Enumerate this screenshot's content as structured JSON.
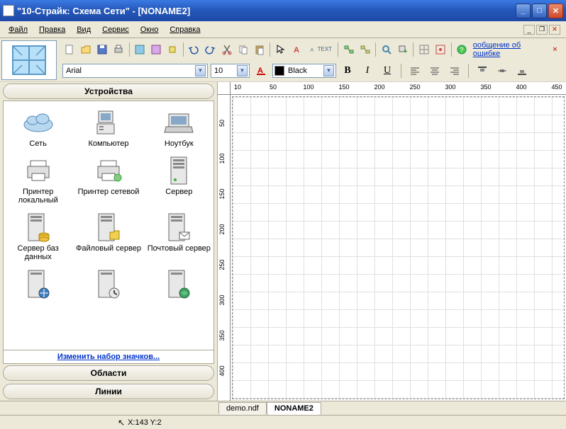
{
  "title": "\"10-Страйк: Схема Сети\" - [NONAME2]",
  "menu": {
    "file": "Файл",
    "edit": "Правка",
    "view": "Вид",
    "service": "Сервис",
    "window": "Окно",
    "help": "Справка"
  },
  "error_link": "ообщение об ошибке",
  "font": {
    "name": "Arial",
    "size": "10"
  },
  "color": {
    "label": "Black",
    "hex": "#000000"
  },
  "format_buttons": {
    "bold": "B",
    "italic": "I",
    "underline": "U"
  },
  "panel": {
    "devices_header": "Устройства",
    "areas_header": "Области",
    "lines_header": "Линии",
    "change_icons": "Изменить набор значков..."
  },
  "devices": [
    {
      "label": "Сеть",
      "icon": "cloud"
    },
    {
      "label": "Компьютер",
      "icon": "computer"
    },
    {
      "label": "Ноутбук",
      "icon": "laptop"
    },
    {
      "label": "Принтер локальный",
      "icon": "printer"
    },
    {
      "label": "Принтер сетевой",
      "icon": "net-printer"
    },
    {
      "label": "Сервер",
      "icon": "server"
    },
    {
      "label": "Сервер баз данных",
      "icon": "db-server"
    },
    {
      "label": "Файловый сервер",
      "icon": "file-server"
    },
    {
      "label": "Почтовый сервер",
      "icon": "mail-server"
    },
    {
      "label": "",
      "icon": "server2"
    },
    {
      "label": "",
      "icon": "server3"
    },
    {
      "label": "",
      "icon": "server4"
    }
  ],
  "ruler_h": [
    "10",
    "50",
    "100",
    "150",
    "200",
    "250",
    "300",
    "350",
    "400",
    "450"
  ],
  "ruler_v": [
    "50",
    "100",
    "150",
    "200",
    "250",
    "300",
    "350",
    "400"
  ],
  "tabs": [
    {
      "label": "demo.ndf",
      "active": false
    },
    {
      "label": "NONAME2",
      "active": true
    }
  ],
  "status": {
    "coords": "X:143  Y:2"
  }
}
